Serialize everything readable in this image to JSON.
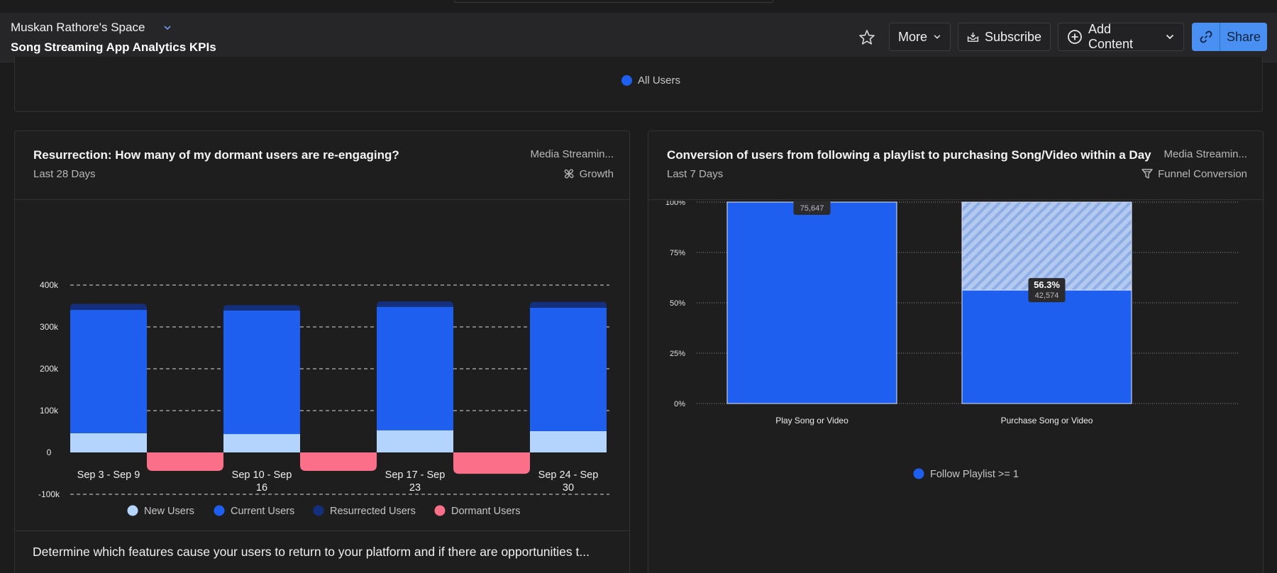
{
  "header": {
    "space_name": "Muskan Rathore's Space",
    "dashboard_title": "Song Streaming App Analytics KPIs",
    "more_label": "More",
    "subscribe_label": "Subscribe",
    "add_content_label": "Add Content",
    "share_label": "Share"
  },
  "top_card": {
    "legend_label": "All Users",
    "legend_color": "#1f5fef"
  },
  "left_card": {
    "title": "Resurrection: How many of my dormant users are re-engaging?",
    "subtitle": "Last 28 Days",
    "project": "Media Streamin...",
    "chart_type_label": "Growth",
    "description": "Determine which features cause your users to return to your platform and if there are opportunities t...",
    "legend": [
      {
        "label": "New Users",
        "color": "#b3d4fd"
      },
      {
        "label": "Current Users",
        "color": "#1f5fef"
      },
      {
        "label": "Resurrected Users",
        "color": "#132f7e"
      },
      {
        "label": "Dormant Users",
        "color": "#fb6f89"
      }
    ]
  },
  "right_card": {
    "title": "Conversion of users from following a playlist to purchasing Song/Video within a Day",
    "subtitle": "Last 7 Days",
    "project": "Media Streamin...",
    "chart_type_label": "Funnel Conversion",
    "legend": [
      {
        "label": "Follow Playlist >= 1",
        "color": "#1f5fef"
      }
    ]
  },
  "chart_data": [
    {
      "type": "bar",
      "stacked": true,
      "categories": [
        "Sep 3 - Sep 9",
        "Sep 10 - Sep 16",
        "Sep 17 - Sep 23",
        "Sep 24 - Sep 30"
      ],
      "y_tick_labels": [
        "-100k",
        "0",
        "100k",
        "200k",
        "300k",
        "400k"
      ],
      "ylim": [
        -100000,
        400000
      ],
      "series": [
        {
          "name": "New Users",
          "values": [
            46000,
            44000,
            53000,
            51000
          ]
        },
        {
          "name": "Current Users",
          "values": [
            295000,
            295000,
            295000,
            295000
          ]
        },
        {
          "name": "Resurrected Users",
          "values": [
            14000,
            13000,
            13000,
            14000
          ]
        },
        {
          "name": "Dormant Users",
          "values": [
            -44000,
            -44000,
            -51000,
            null
          ]
        }
      ],
      "grid": true,
      "legend_position": "bottom"
    },
    {
      "type": "bar",
      "categories": [
        "Play Song or Video",
        "Purchase Song or Video"
      ],
      "y_tick_labels": [
        "0%",
        "25%",
        "50%",
        "75%",
        "100%"
      ],
      "ylim": [
        0,
        100
      ],
      "series": [
        {
          "name": "Follow Playlist >= 1",
          "values": [
            100,
            56.3
          ]
        }
      ],
      "data_labels": [
        {
          "percent": "100%",
          "count": "75,647"
        },
        {
          "percent": "56.3%",
          "count": "42,574"
        }
      ],
      "grid": true,
      "legend_position": "bottom"
    }
  ]
}
